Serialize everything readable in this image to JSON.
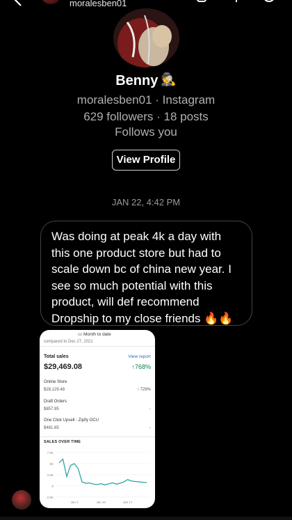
{
  "header": {
    "username": "moralesben01"
  },
  "profile": {
    "name": "Benny",
    "name_emoji": "🕵",
    "handle_line": "moralesben01 · Instagram",
    "stats_line": "629 followers · 18 posts",
    "follows_you": "Follows you",
    "view_profile_label": "View Profile"
  },
  "thread": {
    "timestamp": "JAN 22, 4:42 PM",
    "message": "Was doing at peak 4k a day with this one product store but had to scale down bc of china new year. I see so much potential with this product, will def recommend Dropship to my close friends 🔥🔥"
  },
  "attachment": {
    "date_button": "Month to date",
    "compare": "compared to Dec 27, 2021",
    "total_label": "Total sales",
    "view_report": "View report",
    "total_value": "$29,469.08",
    "total_change": "↑768%",
    "rows": [
      {
        "label": "Online Store",
        "value": "$28,129.48",
        "change": "↑ 729%"
      },
      {
        "label": "Draft Orders",
        "value": "$857.95",
        "change": "-"
      },
      {
        "label": "One Click Upsell - Zipify OCU",
        "value": "$481.65",
        "change": "-"
      }
    ],
    "chart_title": "SALES OVER TIME",
    "chart_data": {
      "type": "line",
      "y_ticks": [
        "7.5K",
        "5K",
        "2.5K",
        "0",
        "-2.5K"
      ],
      "x_ticks": [
        "Jan 3",
        "Jan 10",
        "Jan 17"
      ],
      "ylim": [
        -2500,
        7500
      ],
      "series": [
        {
          "values": [
            5200,
            6000,
            2100,
            4600,
            5000,
            3900,
            900,
            600,
            650,
            400,
            300,
            500,
            250,
            450,
            700,
            400,
            600,
            900,
            1400,
            1100,
            1000,
            900,
            800,
            700
          ]
        }
      ]
    }
  },
  "colors": {
    "background": "#000000",
    "bubble_border": "#454545",
    "chart_line": "#2ba3a3"
  }
}
